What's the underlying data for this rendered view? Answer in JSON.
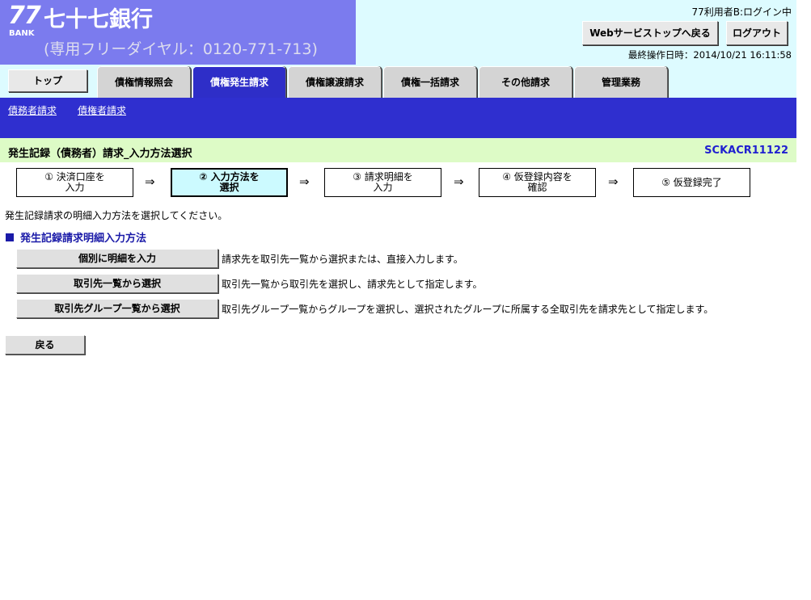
{
  "header": {
    "logo_number": "77",
    "logo_bank": "BANK",
    "bank_name": "七十七銀行",
    "phone": "(専用フリーダイヤル：0120-771-713)",
    "user_status": "77利用者B:ログイン中",
    "web_service_top_label": "Webサービストップへ戻る",
    "logout_label": "ログアウト",
    "last_operation": "最終操作日時：2014/10/21 16:11:58"
  },
  "tabs": [
    {
      "label": "トップ"
    },
    {
      "label": "債権情報照会"
    },
    {
      "label": "債権発生請求",
      "active": true
    },
    {
      "label": "債権譲渡請求"
    },
    {
      "label": "債権一括請求"
    },
    {
      "label": "その他請求"
    },
    {
      "label": "管理業務"
    }
  ],
  "subnav": {
    "items": [
      {
        "label": "債務者請求"
      },
      {
        "label": "債権者請求"
      }
    ]
  },
  "title_bar": {
    "title": "発生記録（債務者）請求_入力方法選択",
    "screen_id": "SCKACR11122"
  },
  "steps": [
    {
      "line1": "① 決済口座を",
      "line2": "入力"
    },
    {
      "line1": "② 入力方法を",
      "line2": "選択",
      "current": true
    },
    {
      "line1": "③ 請求明細を",
      "line2": "入力"
    },
    {
      "line1": "④ 仮登録内容を",
      "line2": "確認"
    },
    {
      "line1": "⑤ 仮登録完了",
      "line2": ""
    }
  ],
  "arrow": "⇒",
  "instruction": "発生記録請求の明細入力方法を選択してください。",
  "section_title": "発生記録請求明細入力方法",
  "options": [
    {
      "button": "個別に明細を入力",
      "description": "請求先を取引先一覧から選択または、直接入力します。"
    },
    {
      "button": "取引先一覧から選択",
      "description": "取引先一覧から取引先を選択し、請求先として指定します。"
    },
    {
      "button": "取引先グループ一覧から選択",
      "description": "取引先グループ一覧からグループを選択し、選択されたグループに所属する全取引先を請求先として指定します。"
    }
  ],
  "back_label": "戻る",
  "colors": {
    "header_blue": "#7b7bee",
    "header_light": "#ddfbff",
    "active_tab": "#2e2ec8",
    "subnav": "#2f2fcf",
    "title_bar": "#ddfbc6",
    "current_step": "#ccfaff"
  }
}
